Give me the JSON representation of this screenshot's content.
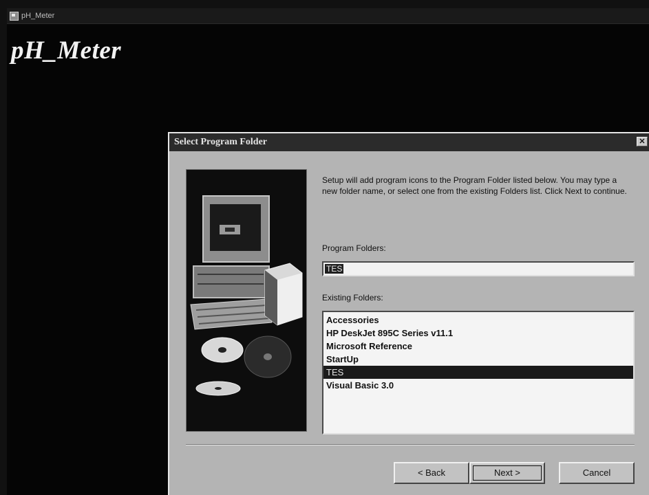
{
  "app": {
    "window_title": "pH_Meter",
    "heading": "pH_Meter"
  },
  "dialog": {
    "title": "Select Program Folder",
    "close_glyph": "✕",
    "description": "Setup will add program icons to the Program Folder listed below. You may type a new folder name, or select one from the existing Folders list.  Click Next to continue.",
    "program_folders_label": "Program Folders:",
    "program_folder_value": "TES",
    "existing_folders_label": "Existing Folders:",
    "existing_folders": [
      "Accessories",
      "HP DeskJet 895C Series v11.1",
      "Microsoft Reference",
      "StartUp",
      "TES",
      "Visual Basic 3.0"
    ],
    "selected_folder": "TES",
    "buttons": {
      "back": "< Back",
      "next": "Next >",
      "cancel": "Cancel"
    }
  },
  "colors": {
    "background": "#050505",
    "dialog_face": "#b4b4b4",
    "titlebar": "#2b2b2b",
    "selection": "#1a1a1a"
  },
  "icons": [
    "window-icon",
    "close-icon",
    "computer-illustration",
    "cd-disc-icon"
  ]
}
